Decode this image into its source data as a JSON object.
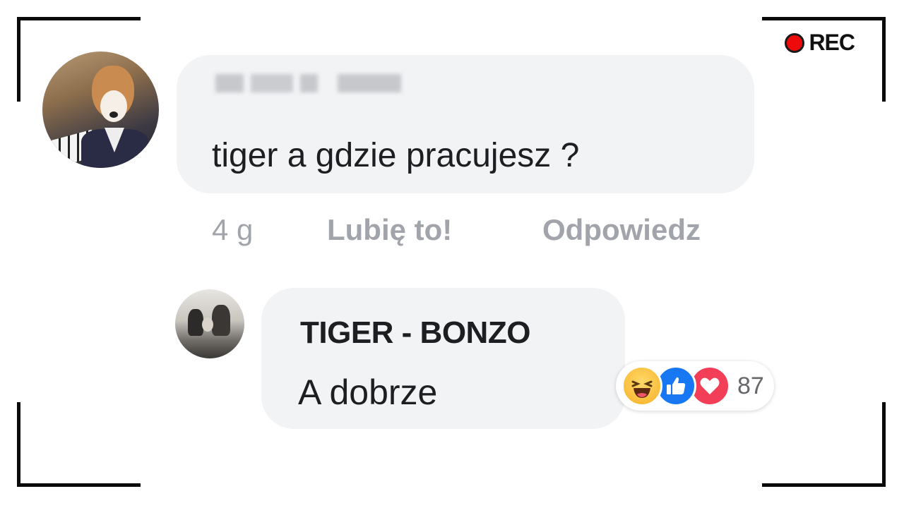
{
  "overlay": {
    "rec_label": "REC",
    "rec_color": "#ee0a0a"
  },
  "comment": {
    "text": "tiger a gdzie pracujesz ?",
    "time": "4 g",
    "like_label": "Lubię to!",
    "reply_label": "Odpowiedz"
  },
  "reply": {
    "author": "TIGER - BONZO",
    "text": "A dobrze",
    "reactions": {
      "icons": [
        "haha-icon",
        "like-icon",
        "love-icon"
      ],
      "count": "87"
    }
  },
  "colors": {
    "bubble": "#f2f3f5",
    "meta_text": "#a1a4aa",
    "like_blue": "#1877f2",
    "love_red": "#f33e58",
    "haha_yellow": "#f7b125"
  }
}
